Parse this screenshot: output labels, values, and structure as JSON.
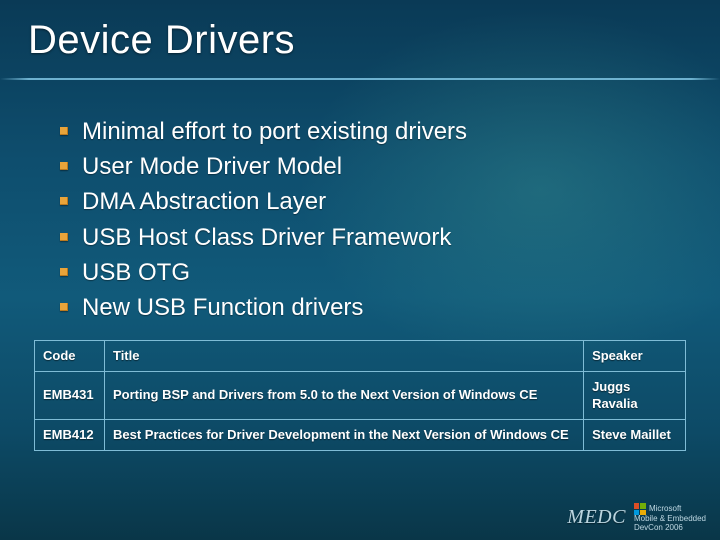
{
  "title": "Device Drivers",
  "bullets": [
    "Minimal effort to port existing drivers",
    "User Mode Driver Model",
    "DMA Abstraction Layer",
    "USB Host Class Driver Framework",
    "USB OTG",
    "New USB Function drivers"
  ],
  "table": {
    "headers": {
      "code": "Code",
      "title": "Title",
      "speaker": "Speaker"
    },
    "rows": [
      {
        "code": "EMB431",
        "title": "Porting BSP and Drivers from 5.0 to the Next Version of Windows CE",
        "speaker": "Juggs Ravalia"
      },
      {
        "code": "EMB412",
        "title": "Best Practices for Driver Development in the Next Version of Windows CE",
        "speaker": "Steve Maillet"
      }
    ]
  },
  "footer": {
    "brand": "MEDC",
    "ms": "Microsoft",
    "sub1": "Mobile & Embedded",
    "sub2": "DevCon 2006"
  }
}
